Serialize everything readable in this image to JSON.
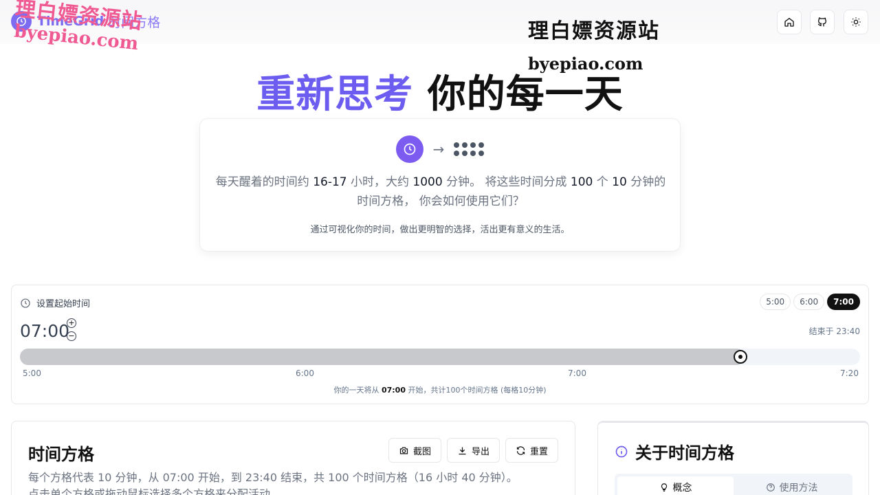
{
  "header": {
    "brand_name": "TimeGrid",
    "brand_sub": "时间方格",
    "watermark_cn": "理白嫖资源站",
    "watermark_url": "byepiao.com",
    "home_icon": "home-icon",
    "github_icon": "github-icon",
    "theme_icon": "sun-icon"
  },
  "hero": {
    "accent": "重新思考",
    "rest": "你的每一天",
    "accent_color": "#6d5cf0"
  },
  "intro": {
    "p1": "每天醒着的时间约",
    "b1": "16-17",
    "p2": "小时，大约",
    "b2": "1000",
    "p3": "分钟。 将这些时间分成",
    "b3": "100",
    "p4": "个",
    "b4": "10",
    "p5": "分钟的时间方格， 你会如何使用它们？",
    "subtitle": "通过可视化你的时间，做出更明智的选择，活出更有意义的生活。"
  },
  "start_time": {
    "heading": "设置起始时间",
    "presets": [
      "5:00",
      "6:00",
      "7:00"
    ],
    "active_preset": "7:00",
    "current": "07:00",
    "plus": "+",
    "minus": "−",
    "ends_at": "结束于 23:40",
    "slider_fraction": 0.858,
    "ticks": [
      "5:00",
      "6:00",
      "7:00",
      "7:20"
    ],
    "footer_a": "你的一天将从",
    "footer_time": "07:00",
    "footer_b": "开始，共计100个时间方格 (每格10分钟)"
  },
  "grid": {
    "title": "时间方格",
    "screenshot_label": "截图",
    "export_label": "导出",
    "reset_label": "重置",
    "desc_line1": "每个方格代表 10 分钟，从 07:00 开始，到 23:40 结束，共 100 个时间方格（16 小时 40 分钟）。",
    "desc_line2": "点击单个方格或拖动鼠标选择多个方格来分配活动。"
  },
  "about": {
    "title": "关于时间方格",
    "tab_concept": "概念",
    "tab_usage": "使用方法",
    "accent_color": "#6d5cf0"
  }
}
